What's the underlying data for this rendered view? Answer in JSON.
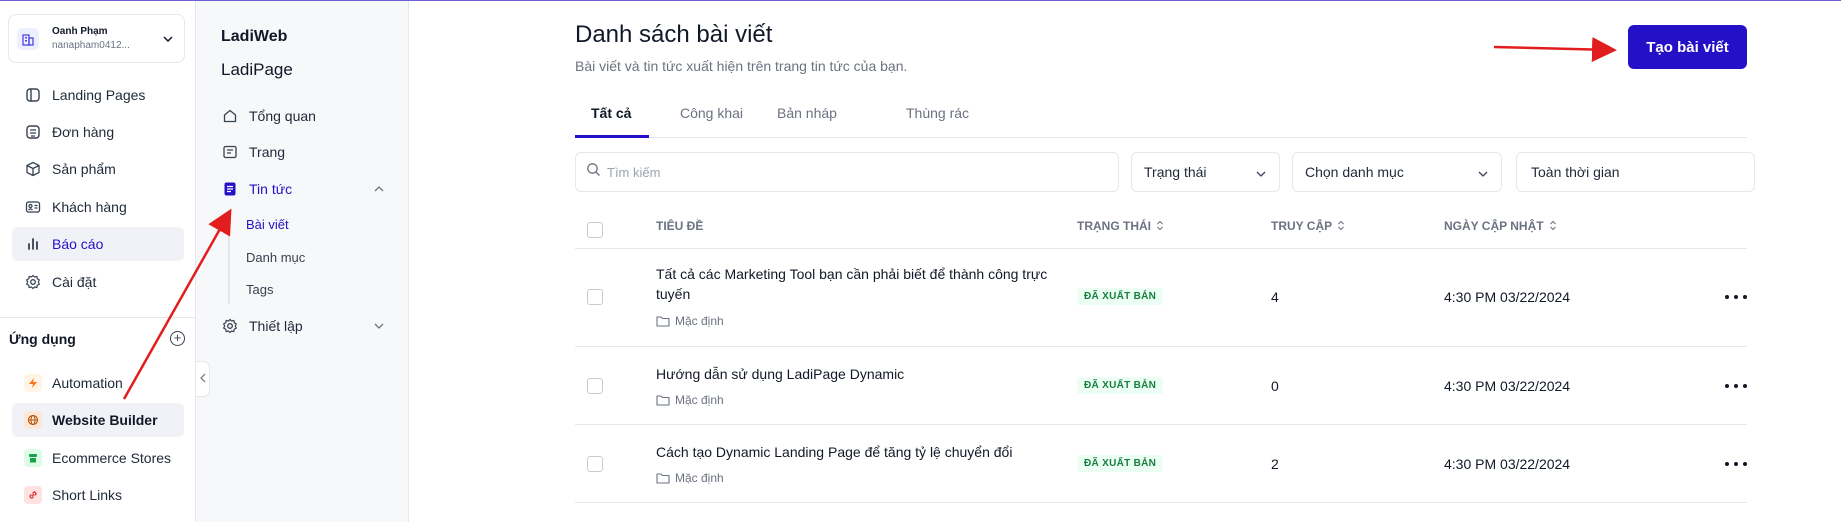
{
  "account": {
    "name": "Oanh Phạm",
    "email": "nanapham0412..."
  },
  "sidebar": {
    "items": [
      {
        "label": "Landing Pages",
        "icon": "landing-pages-icon"
      },
      {
        "label": "Đơn hàng",
        "icon": "orders-icon"
      },
      {
        "label": "Sản phẩm",
        "icon": "box-icon"
      },
      {
        "label": "Khách hàng",
        "icon": "contact-card-icon"
      },
      {
        "label": "Báo cáo",
        "icon": "bar-chart-icon"
      },
      {
        "label": "Cài đặt",
        "icon": "gear-icon"
      }
    ],
    "apps_title": "Ứng dụng",
    "apps": [
      {
        "label": "Automation",
        "icon": "lightning-icon",
        "color": "#f97316"
      },
      {
        "label": "Website Builder",
        "icon": "globe-icon",
        "color": "#b45309"
      },
      {
        "label": "Ecommerce Stores",
        "icon": "store-icon",
        "color": "#16a34a"
      },
      {
        "label": "Short Links",
        "icon": "link-icon",
        "color": "#dc2626"
      }
    ]
  },
  "panel": {
    "title": "LadiWeb",
    "subtitle": "LadiPage",
    "items": [
      {
        "label": "Tổng quan",
        "icon": "home-icon"
      },
      {
        "label": "Trang",
        "icon": "page-icon"
      },
      {
        "label": "Tin tức",
        "icon": "news-icon"
      },
      {
        "label": "Thiết lập",
        "icon": "gear-icon"
      }
    ],
    "subitems": [
      "Bài viết",
      "Danh mục",
      "Tags"
    ]
  },
  "main": {
    "title": "Danh sách bài viết",
    "description": "Bài viết và tin tức xuất hiện trên trang tin tức của bạn.",
    "create_button": "Tạo bài viết",
    "tabs": [
      "Tất cả",
      "Công khai",
      "Bản nháp",
      "Thùng rác"
    ],
    "search_placeholder": "Tìm kiếm",
    "filters": {
      "status": "Trạng thái",
      "category": "Chọn danh mục",
      "time": "Toàn thời gian"
    },
    "columns": {
      "title": "TIÊU ĐỀ",
      "status": "TRẠNG THÁI",
      "visits": "TRUY CẬP",
      "updated": "NGÀY CẬP NHẬT"
    },
    "rows": [
      {
        "title": "Tất cả các Marketing Tool bạn cần phải biết để thành công trực tuyến",
        "category": "Mặc định",
        "status": "ĐÃ XUẤT BẢN",
        "visits": "4",
        "updated": "4:30 PM 03/22/2024"
      },
      {
        "title": "Hướng dẫn sử dụng LadiPage Dynamic",
        "category": "Mặc định",
        "status": "ĐÃ XUẤT BẢN",
        "visits": "0",
        "updated": "4:30 PM 03/22/2024"
      },
      {
        "title": "Cách tạo Dynamic Landing Page để tăng tỷ lệ chuyển đổi",
        "category": "Mặc định",
        "status": "ĐÃ XUẤT BẢN",
        "visits": "2",
        "updated": "4:30 PM 03/22/2024"
      }
    ]
  },
  "colors": {
    "accent": "#2410c7",
    "annotation": "#e11d1d",
    "badge": "#15803d"
  }
}
